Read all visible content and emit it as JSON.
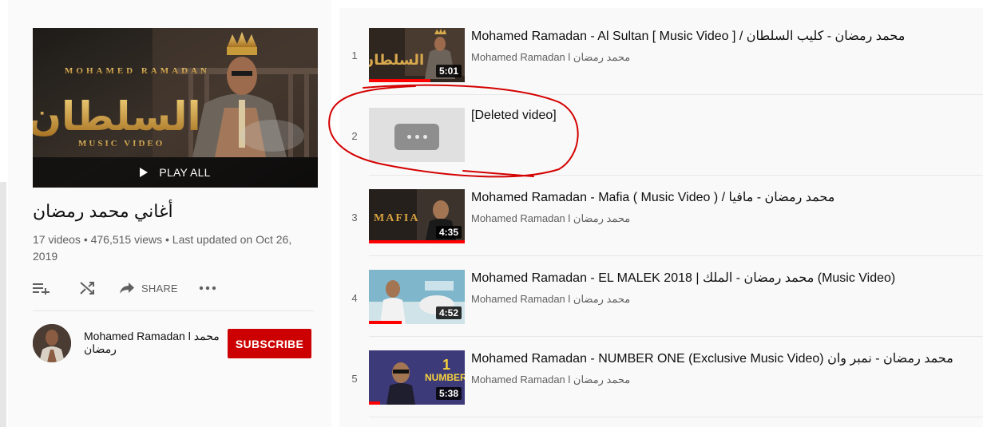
{
  "playlist": {
    "play_all_label": "PLAY ALL",
    "title": "أغاني محمد رمضان",
    "meta": "17 videos • 476,515 views • Last updated on Oct 26, 2019",
    "share_label": "SHARE",
    "channel_name": "Mohamed Ramadan l محمد رمضان",
    "subscribe_label": "SUBSCRIBE"
  },
  "thumbnail_text": {
    "artist": "MOHAMED RAMADAN",
    "arabic_title": "السلطان",
    "subtitle": "MUSIC VIDEO"
  },
  "videos": [
    {
      "index": "1",
      "title": "Mohamed Ramadan - Al Sultan [ Music Video ] / محمد رمضان - كليب السلطان",
      "channel": "Mohamed Ramadan l محمد رمضان",
      "duration": "5:01",
      "deleted": false,
      "thumb_color": "#3b2d22"
    },
    {
      "index": "2",
      "title": "[Deleted video]",
      "channel": "",
      "duration": "",
      "deleted": true,
      "thumb_color": "#e0e0e0"
    },
    {
      "index": "3",
      "title": "Mohamed Ramadan - Mafia ( Music Video ) / محمد رمضان - مافيا",
      "channel": "Mohamed Ramadan l محمد رمضان",
      "duration": "4:35",
      "deleted": false,
      "thumb_color": "#2a2420"
    },
    {
      "index": "4",
      "title": "Mohamed Ramadan - EL MALEK 2018 | محمد رمضان - الملك (Music Video)",
      "channel": "Mohamed Ramadan l محمد رمضان",
      "duration": "4:52",
      "deleted": false,
      "thumb_color": "#7fb6cc"
    },
    {
      "index": "5",
      "title": "Mohamed Ramadan - NUMBER ONE (Exclusive Music Video) محمد رمضان - نمبر وان",
      "channel": "Mohamed Ramadan l محمد رمضان",
      "duration": "5:38",
      "deleted": false,
      "thumb_color": "#3d3a7a"
    }
  ],
  "colors": {
    "subscribe": "#cc0000",
    "progress": "#ff0000",
    "annotation": "#d40000"
  },
  "icons": [
    "add-to-queue-icon",
    "shuffle-icon",
    "share-icon",
    "more-icon",
    "play-icon"
  ]
}
